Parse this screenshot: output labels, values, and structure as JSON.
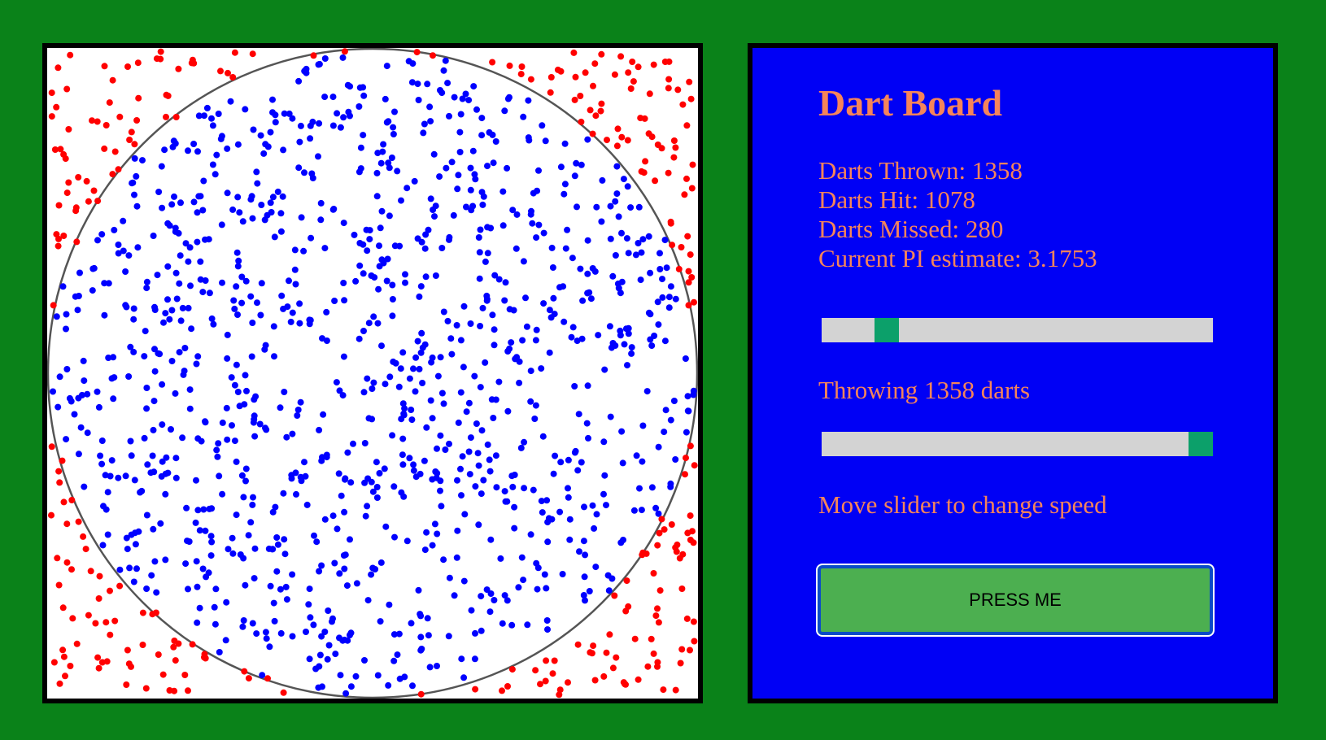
{
  "colors": {
    "page_background": "#0a8219",
    "panel_background": "#0000f5",
    "panel_text": "#f5845a",
    "hit_dot": "#0000ff",
    "miss_dot": "#ff0000",
    "slider_track": "#d3d3d3",
    "slider_thumb": "#0ca06a",
    "button_background": "#4caf50"
  },
  "panel": {
    "title": "Dart Board",
    "stats": {
      "thrown": "Darts Thrown: 1358",
      "hit": "Darts Hit: 1078",
      "missed": "Darts Missed: 280",
      "pi": "Current PI estimate: 3.1753"
    },
    "darts_slider": {
      "value_fraction": 0.145,
      "label": "Throwing 1358 darts"
    },
    "speed_slider": {
      "value_fraction": 1.0,
      "label": "Move slider to change speed"
    },
    "button_label": "PRESS ME"
  },
  "board": {
    "darts_thrown": 1358,
    "darts_hit": 1078,
    "darts_missed": 280
  }
}
